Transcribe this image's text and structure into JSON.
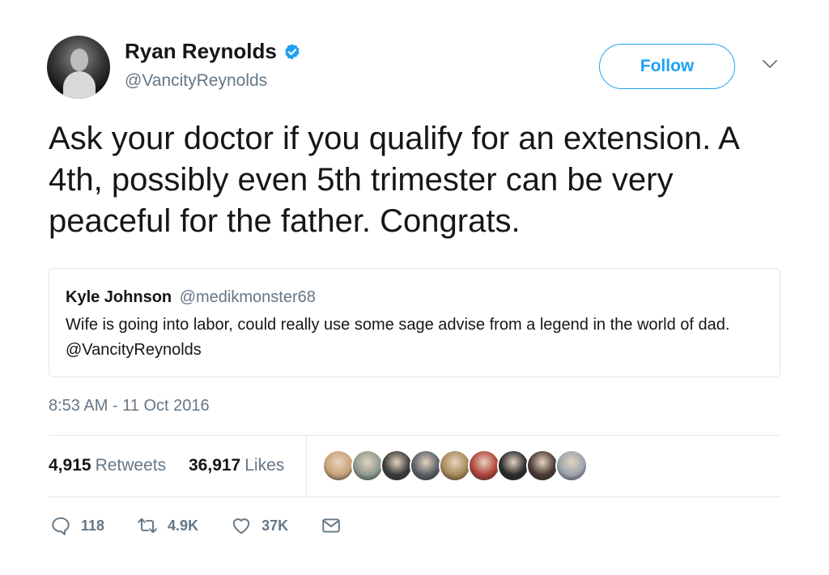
{
  "tweet": {
    "author_name": "Ryan Reynolds",
    "author_handle": "@VancityReynolds",
    "follow_label": "Follow",
    "text": "Ask your doctor if you qualify for an extension. A 4th, possibly even 5th trimester can be very peaceful for the father. Congrats.",
    "timestamp": "8:53 AM - 11 Oct 2016",
    "icons": [
      "verified-badge-icon",
      "chevron-down-icon"
    ]
  },
  "quoted_tweet": {
    "author_name": "Kyle Johnson",
    "author_handle": "@medikmonster68",
    "text": "Wife is going into labor, could really use some sage advise from a legend in the world of dad. @VancityReynolds"
  },
  "stats": {
    "retweets_count": "4,915",
    "retweets_label": "Retweets",
    "likes_count": "36,917",
    "likes_label": "Likes"
  },
  "likers": [
    {
      "color": "#c9a27a"
    },
    {
      "color": "#8c9a8f"
    },
    {
      "color": "#3b3b3b"
    },
    {
      "color": "#5a5f66"
    },
    {
      "color": "#a88a5a"
    },
    {
      "color": "#b0433a"
    },
    {
      "color": "#2a2a2a"
    },
    {
      "color": "#4a3a36"
    },
    {
      "color": "#9ba3ad"
    }
  ],
  "actions": {
    "reply_count": "118",
    "retweet_count": "4.9K",
    "like_count": "37K",
    "icons": [
      "reply-icon",
      "retweet-icon",
      "heart-icon",
      "direct-message-icon"
    ]
  },
  "colors": {
    "accent": "#1da1f2",
    "secondary_text": "#657786",
    "border": "#e1e8ed"
  }
}
